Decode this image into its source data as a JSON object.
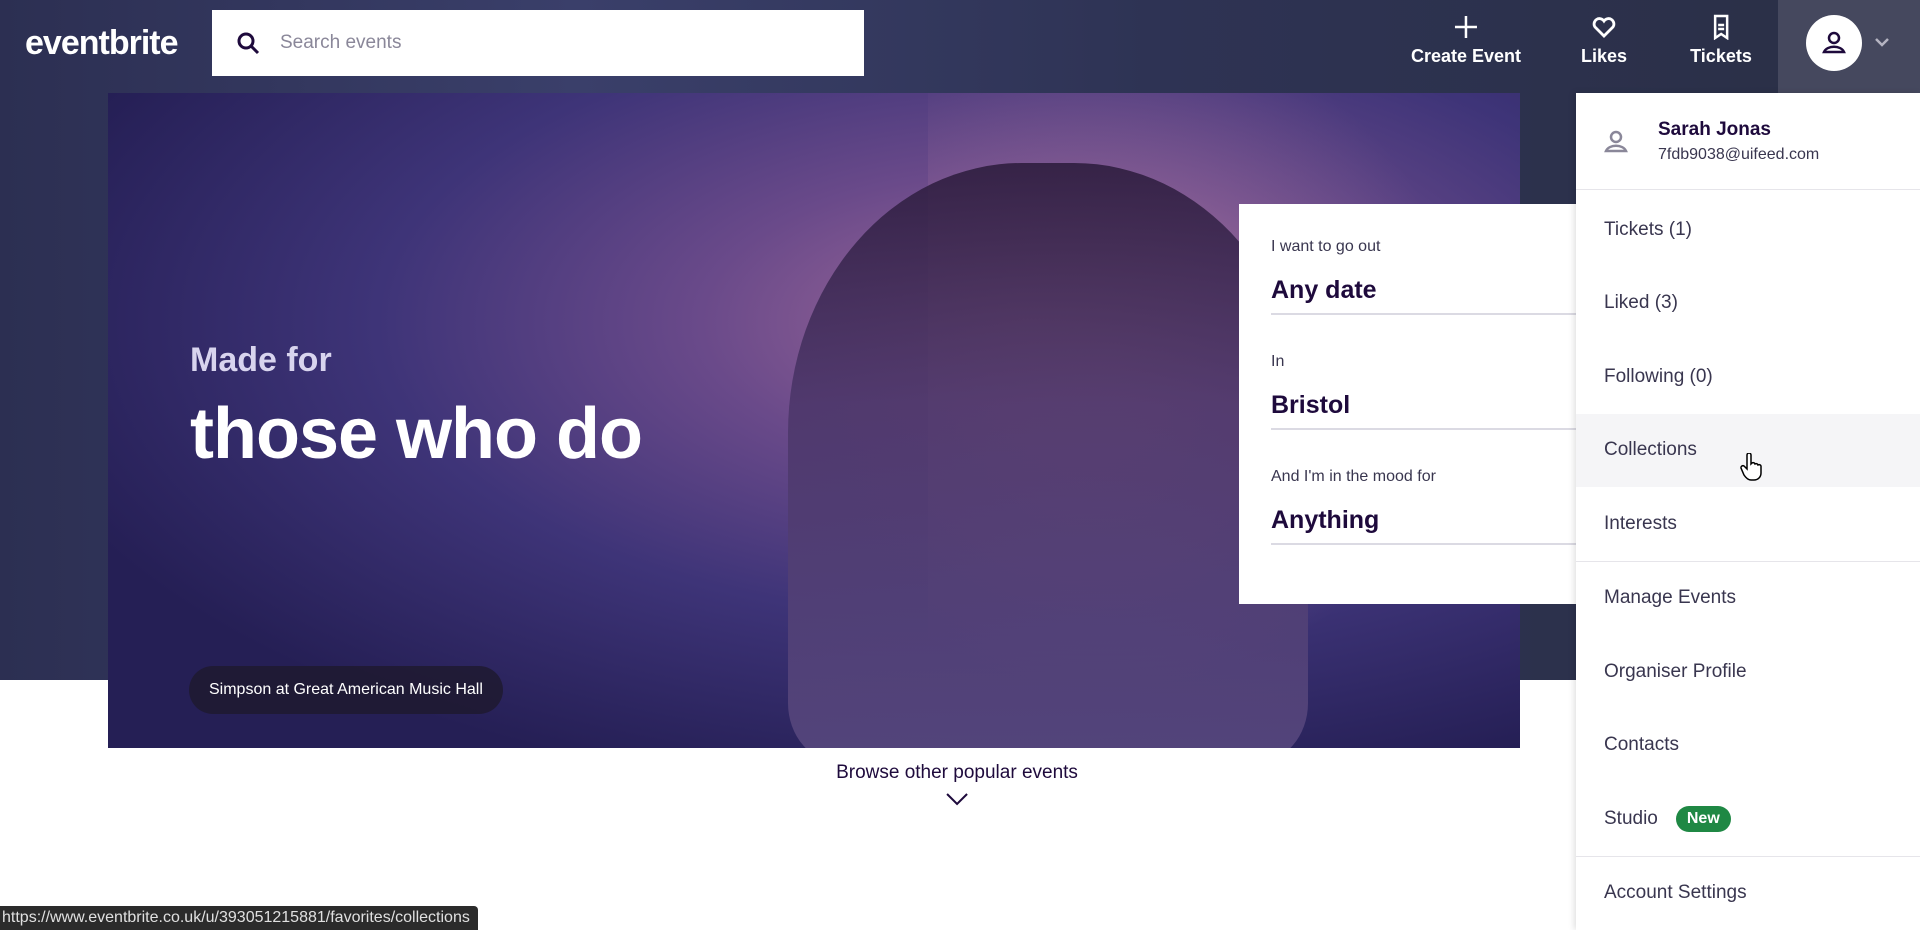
{
  "header": {
    "logo": "eventbrite",
    "search_placeholder": "Search events",
    "create_event": "Create Event",
    "likes": "Likes",
    "tickets": "Tickets"
  },
  "hero": {
    "line1": "Made for",
    "line2": "those who do",
    "caption": "Simpson at Great American Music Hall"
  },
  "filter": {
    "date_label": "I want to go out",
    "date_value": "Any date",
    "location_label": "In",
    "location_value": "Bristol",
    "mood_label": "And I'm in the mood for",
    "mood_value": "Anything"
  },
  "browse": "Browse other popular events",
  "menu": {
    "name": "Sarah Jonas",
    "email": "7fdb9038@uifeed.com",
    "items": [
      "Tickets (1)",
      "Liked (3)",
      "Following (0)",
      "Collections",
      "Interests",
      "Manage Events",
      "Organiser Profile",
      "Contacts",
      "Studio",
      "Account Settings"
    ],
    "badge": "New",
    "badge_color": "#1f8844"
  },
  "status_url": "https://www.eventbrite.co.uk/u/393051215881/favorites/collections"
}
